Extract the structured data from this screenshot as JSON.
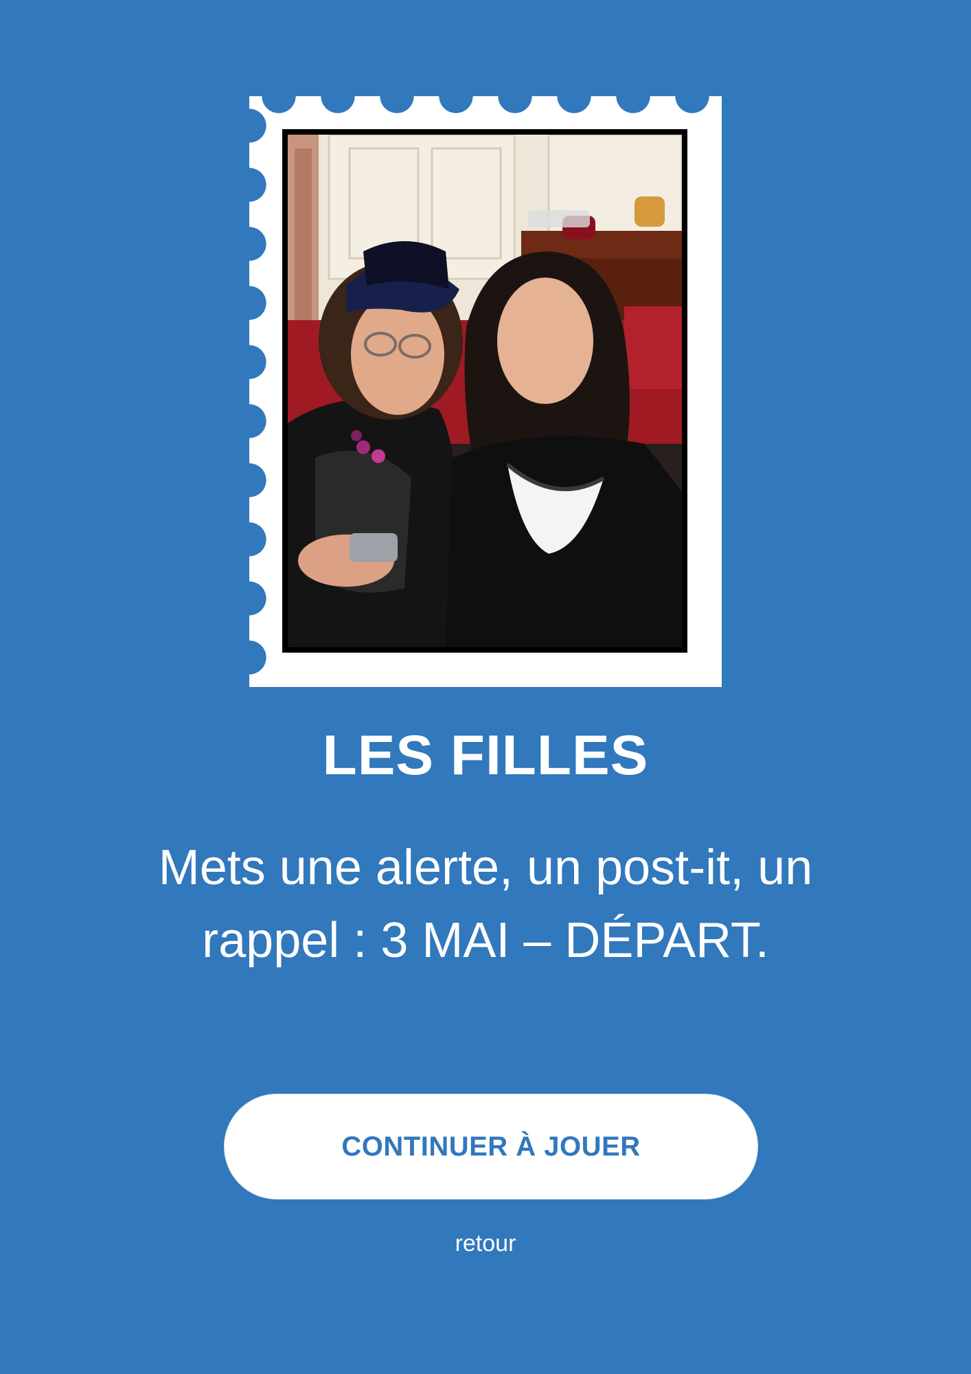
{
  "colors": {
    "background": "#3178bc",
    "stamp": "#ffffff",
    "button_text": "#3178bc"
  },
  "photo": {
    "icon": "photo-two-women-icon"
  },
  "title": "LES FILLES",
  "message": "Mets une alerte, un post-it, un rappel : 3 MAI – DÉPART.",
  "continue_button": {
    "label": "CONTINUER À JOUER"
  },
  "back_link": {
    "label": "retour"
  }
}
